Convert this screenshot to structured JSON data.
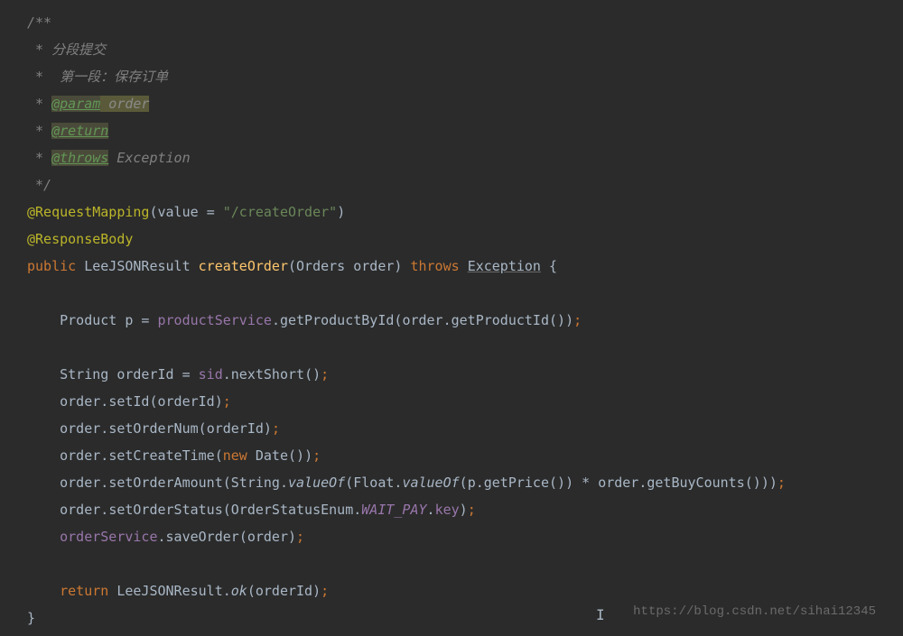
{
  "comment": {
    "open": "/**",
    "line1": " * 分段提交",
    "line2": " *  第一段：保存订单",
    "param_star": " * ",
    "param_tag": "@param",
    "param_name": " order",
    "return_star": " * ",
    "return_tag": "@return",
    "throws_star": " * ",
    "throws_tag": "@throws",
    "throws_type": " Exception",
    "close": " */"
  },
  "anno1": {
    "name": "@RequestMapping",
    "open": "(",
    "attr": "value ",
    "eq": "= ",
    "value": "\"/createOrder\"",
    "close": ")"
  },
  "anno2": "@ResponseBody",
  "method": {
    "modifier": "public ",
    "returnType": "LeeJSONResult ",
    "name": "createOrder",
    "params": "(Orders order) ",
    "throws": "throws ",
    "exception": "Exception",
    "brace": " {"
  },
  "line_prod": {
    "indent": "    ",
    "decl": "Product p = ",
    "svc": "productService",
    "dot1": ".",
    "m1": "getProductById",
    "open1": "(",
    "arg1a": "order",
    "dot2": ".",
    "m2": "getProductId",
    "paren2": "()",
    "close1": ")",
    "semi": ";"
  },
  "line_orderid": {
    "indent": "    ",
    "decl": "String orderId = ",
    "svc": "sid",
    "dot": ".",
    "m": "nextShort",
    "paren": "()",
    "semi": ";"
  },
  "line_setid": {
    "indent": "    ",
    "obj": "order",
    "dot": ".",
    "m": "setId",
    "open": "(",
    "arg": "orderId",
    "close": ")",
    "semi": ";"
  },
  "line_setnum": {
    "indent": "    ",
    "obj": "order",
    "dot": ".",
    "m": "setOrderNum",
    "open": "(",
    "arg": "orderId",
    "close": ")",
    "semi": ";"
  },
  "line_settime": {
    "indent": "    ",
    "obj": "order",
    "dot": ".",
    "m": "setCreateTime",
    "open": "(",
    "new": "new ",
    "cls": "Date",
    "paren": "()",
    "close": ")",
    "semi": ";"
  },
  "line_setamount": {
    "indent": "    ",
    "obj": "order",
    "dot": ".",
    "m": "setOrderAmount",
    "open": "(",
    "cls1": "String",
    "dot1": ".",
    "sm1": "valueOf",
    "open1": "(",
    "cls2": "Float",
    "dot2": ".",
    "sm2": "valueOf",
    "open2": "(",
    "p": "p",
    "dot3": ".",
    "m3": "getPrice",
    "paren3": "()",
    "close2": ") ",
    "op": "* ",
    "obj2": "order",
    "dot4": ".",
    "m4": "getBuyCounts",
    "paren4": "()",
    "close1": ")",
    "close": ")",
    "semi": ";"
  },
  "line_setstatus": {
    "indent": "    ",
    "obj": "order",
    "dot": ".",
    "m": "setOrderStatus",
    "open": "(",
    "cls": "OrderStatusEnum",
    "dot1": ".",
    "enumval": "WAIT_PAY",
    "dot2": ".",
    "field": "key",
    "close": ")",
    "semi": ";"
  },
  "line_save": {
    "indent": "    ",
    "svc": "orderService",
    "dot": ".",
    "m": "saveOrder",
    "open": "(",
    "arg": "order",
    "close": ")",
    "semi": ";"
  },
  "line_return": {
    "indent": "    ",
    "kw": "return ",
    "cls": "LeeJSONResult",
    "dot": ".",
    "sm": "ok",
    "open": "(",
    "arg": "orderId",
    "close": ")",
    "semi": ";"
  },
  "close_brace": "}",
  "watermark": "https://blog.csdn.net/sihai12345"
}
